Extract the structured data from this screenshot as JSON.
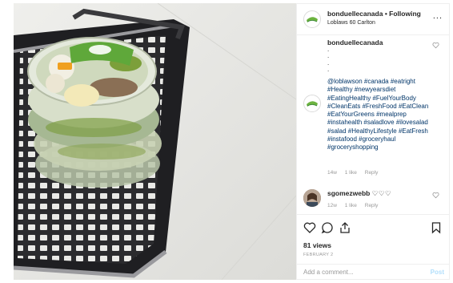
{
  "post": {
    "username": "bonduellecanada",
    "follow_separator": "•",
    "follow_label": "Following",
    "location": "Loblaws 60 Carlton",
    "more_label": "...",
    "caption": {
      "username": "bonduellecanada",
      "dots": ".\n.\n.\n.",
      "hashtags": "@loblawson #canada #eatright #Healthy #newyearsdiet #EatingHealthy #FuelYourBody #CleanEats #FreshFood #EatClean #EatYourGreens #mealprep #instahealth #saladlove #ilovesalad #salad #HealthyLifestyle #EatFresh #instafood #groceryhaul #groceryshopping",
      "age": "14w",
      "likes": "1 like",
      "reply": "Reply"
    },
    "comment": {
      "username": "sgomezwebb",
      "text": "♡♡♡",
      "age": "12w",
      "likes": "1 like",
      "reply": "Reply"
    },
    "views": "81 views",
    "date": "FEBRUARY 2",
    "add_comment_placeholder": "Add a comment...",
    "post_label": "Post"
  },
  "icons": [
    "like-icon",
    "comment-icon",
    "share-icon",
    "bookmark-icon",
    "more-options-icon"
  ],
  "colors": {
    "hashtag": "#003569",
    "muted": "#999999",
    "post_button": "#b2dffc",
    "brand_green": "#6cb33f"
  }
}
